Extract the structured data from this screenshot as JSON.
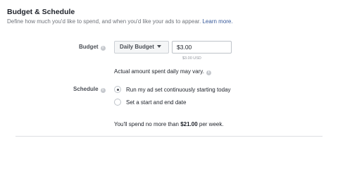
{
  "section": {
    "title": "Budget & Schedule",
    "subtitle": "Define how much you'd like to spend, and when you'd like your ads to appear.",
    "learn_more": "Learn more."
  },
  "budget": {
    "label": "Budget",
    "type_selected": "Daily Budget",
    "amount": "$3.00",
    "currency_note": "$3.00 USD",
    "note": "Actual amount spent daily may vary."
  },
  "schedule": {
    "label": "Schedule",
    "options": [
      {
        "label": "Run my ad set continuously starting today",
        "selected": true
      },
      {
        "label": "Set a start and end date",
        "selected": false
      }
    ]
  },
  "summary": {
    "prefix": "You'll spend no more than ",
    "amount": "$21.00",
    "suffix": " per week."
  },
  "icons": {
    "info": "info-icon",
    "dropdown": "caret-down-icon"
  }
}
